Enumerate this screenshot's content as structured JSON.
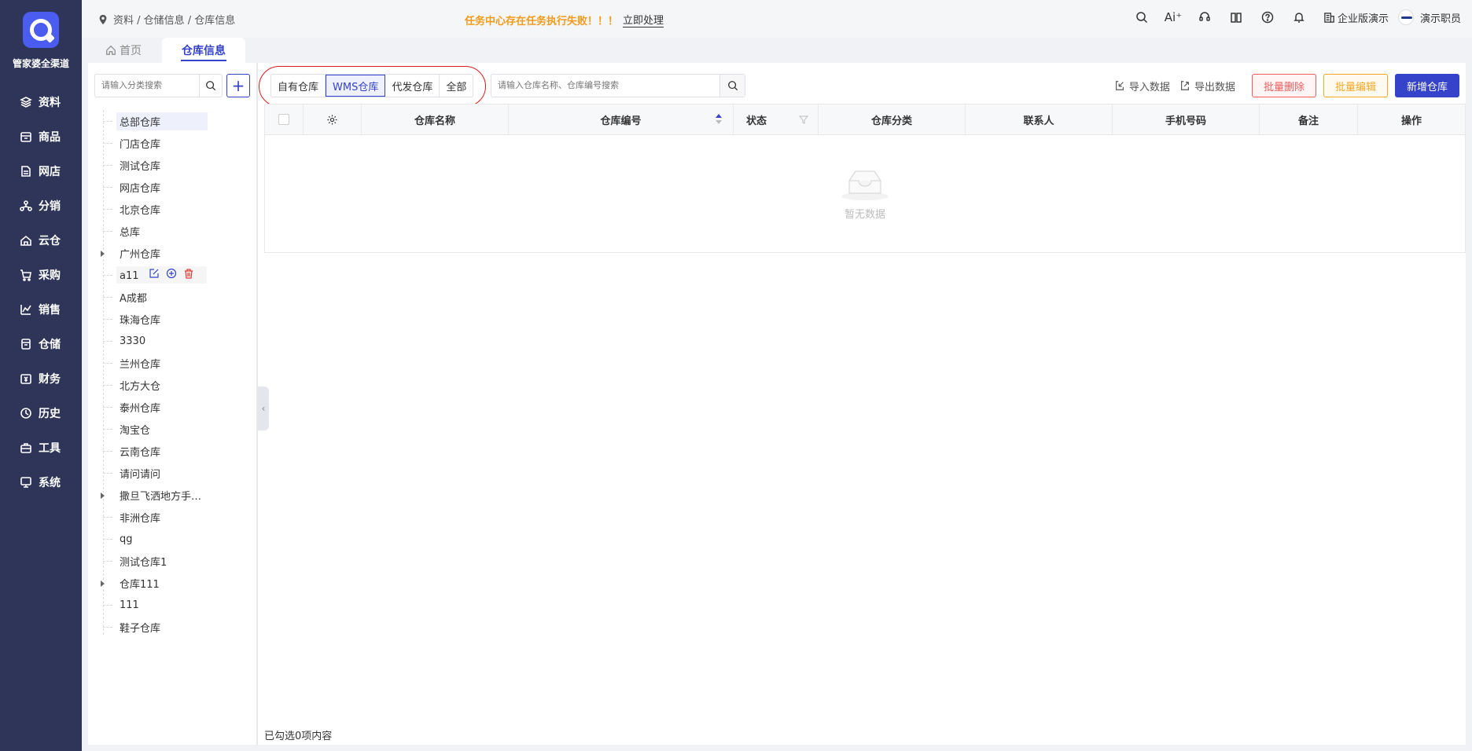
{
  "app": {
    "name": "管家婆全渠道"
  },
  "nav": [
    {
      "label": "资料",
      "icon": "layers-icon"
    },
    {
      "label": "商品",
      "icon": "box-icon"
    },
    {
      "label": "网店",
      "icon": "document-icon"
    },
    {
      "label": "分销",
      "icon": "network-icon"
    },
    {
      "label": "云仓",
      "icon": "cloud-house-icon"
    },
    {
      "label": "采购",
      "icon": "cart-icon"
    },
    {
      "label": "销售",
      "icon": "chart-icon"
    },
    {
      "label": "仓储",
      "icon": "storage-icon"
    },
    {
      "label": "财务",
      "icon": "finance-icon"
    },
    {
      "label": "历史",
      "icon": "history-icon"
    },
    {
      "label": "工具",
      "icon": "toolbox-icon"
    },
    {
      "label": "系统",
      "icon": "monitor-icon"
    }
  ],
  "header": {
    "breadcrumb": "资料 / 仓储信息 / 仓库信息",
    "alert": "任务中心存在任务执行失败！！！",
    "alert_action": "立即处理",
    "enterprise": "企业版演示",
    "user": "演示职员",
    "ai_label": "Ai⁺"
  },
  "tabs": {
    "home": "首页",
    "active": "仓库信息"
  },
  "tree": {
    "search_placeholder": "请输入分类搜索",
    "add_label": "+",
    "nodes": [
      {
        "label": "总部仓库",
        "selected": true
      },
      {
        "label": "门店仓库"
      },
      {
        "label": "测试仓库"
      },
      {
        "label": "网店仓库"
      },
      {
        "label": "北京仓库"
      },
      {
        "label": "总库"
      },
      {
        "label": "广州仓库",
        "expandable": true
      },
      {
        "label": "a11",
        "hover": true
      },
      {
        "label": "A成都"
      },
      {
        "label": "珠海仓库"
      },
      {
        "label": "3330"
      },
      {
        "label": "兰州仓库"
      },
      {
        "label": "北方大仓"
      },
      {
        "label": "泰州仓库"
      },
      {
        "label": "淘宝仓"
      },
      {
        "label": "云南仓库"
      },
      {
        "label": "请问请问"
      },
      {
        "label": "撒旦飞洒地方手…",
        "expandable": true
      },
      {
        "label": "非洲仓库"
      },
      {
        "label": "qg"
      },
      {
        "label": "测试仓库1"
      },
      {
        "label": "仓库111",
        "expandable": true
      },
      {
        "label": "111"
      },
      {
        "label": "鞋子仓库"
      }
    ]
  },
  "filters": [
    "自有仓库",
    "WMS仓库",
    "代发仓库",
    "全部"
  ],
  "active_filter": "WMS仓库",
  "search": {
    "placeholder": "请输入仓库名称、仓库编号搜索"
  },
  "toolbar": {
    "import": "导入数据",
    "export": "导出数据",
    "batch_delete": "批量删除",
    "batch_edit": "批量编辑",
    "new": "新增仓库"
  },
  "table": {
    "columns": [
      "仓库名称",
      "仓库编号",
      "状态",
      "仓库分类",
      "联系人",
      "手机号码",
      "备注",
      "操作"
    ],
    "empty_text": "暂无数据"
  },
  "footer": {
    "selected_text": "已勾选0项内容"
  },
  "colors": {
    "sidebar": "#2e3559",
    "accent": "#3443c9",
    "warning": "#f29a1a",
    "danger": "#f25c5c"
  }
}
